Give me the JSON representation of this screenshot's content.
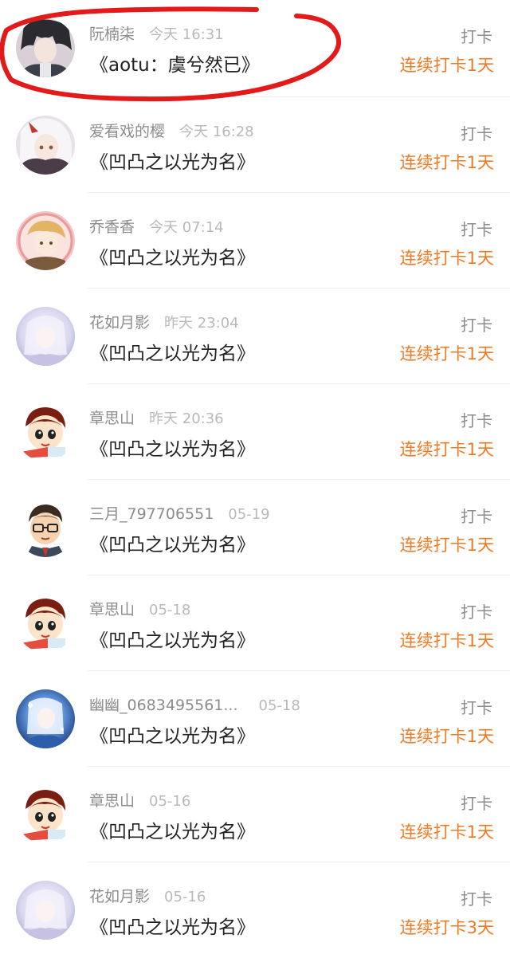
{
  "checkins": [
    {
      "name": "阮楠柒",
      "time": "今天 16:31",
      "book": "《aotu：虞兮然已》",
      "action": "打卡",
      "streak": "连续打卡1天",
      "avatar": "avatar-anime-dark"
    },
    {
      "name": "爱看戏的樱",
      "time": "今天 16:28",
      "book": "《凹凸之以光为名》",
      "action": "打卡",
      "streak": "连续打卡1天",
      "avatar": "avatar-anime-white"
    },
    {
      "name": "乔香香",
      "time": "今天 07:14",
      "book": "《凹凸之以光为名》",
      "action": "打卡",
      "streak": "连续打卡1天",
      "avatar": "avatar-anime-blonde"
    },
    {
      "name": "花如月影",
      "time": "昨天 23:04",
      "book": "《凹凸之以光为名》",
      "action": "打卡",
      "streak": "连续打卡1天",
      "avatar": "avatar-anime-pale"
    },
    {
      "name": "章思山",
      "time": "昨天 20:36",
      "book": "《凹凸之以光为名》",
      "action": "打卡",
      "streak": "连续打卡1天",
      "avatar": "avatar-cartoon-boy"
    },
    {
      "name": "三月_797706551",
      "time": "05-19",
      "book": "《凹凸之以光为名》",
      "action": "打卡",
      "streak": "连续打卡1天",
      "avatar": "avatar-cartoon-glasses"
    },
    {
      "name": "章思山",
      "time": "05-18",
      "book": "《凹凸之以光为名》",
      "action": "打卡",
      "streak": "连续打卡1天",
      "avatar": "avatar-cartoon-boy"
    },
    {
      "name": "幽幽_0683495561...",
      "time": "05-18",
      "book": "《凹凸之以光为名》",
      "action": "打卡",
      "streak": "连续打卡1天",
      "avatar": "avatar-anime-blue"
    },
    {
      "name": "章思山",
      "time": "05-16",
      "book": "《凹凸之以光为名》",
      "action": "打卡",
      "streak": "连续打卡1天",
      "avatar": "avatar-cartoon-boy"
    },
    {
      "name": "花如月影",
      "time": "05-16",
      "book": "《凹凸之以光为名》",
      "action": "打卡",
      "streak": "连续打卡3天",
      "avatar": "avatar-anime-pale"
    }
  ],
  "colors": {
    "accent": "#f07a23",
    "highlight": "#e31a1a"
  }
}
